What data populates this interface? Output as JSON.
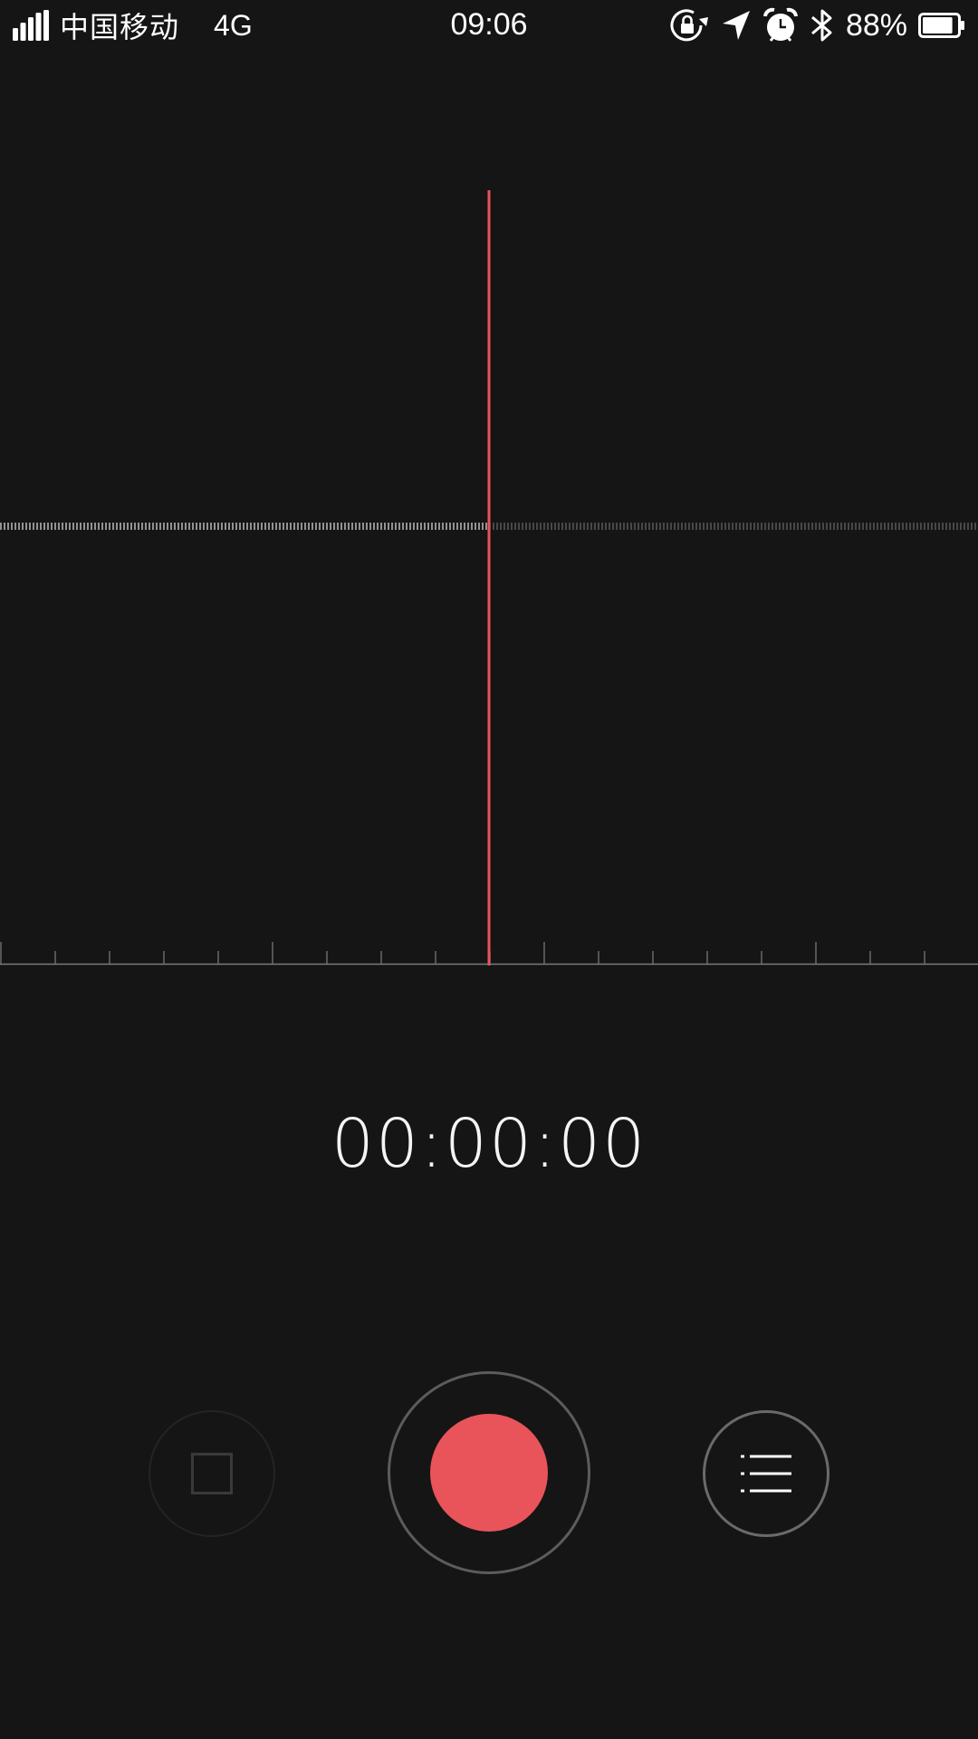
{
  "status_bar": {
    "carrier": "中国移动",
    "network": "4G",
    "time": "09:06",
    "battery_percent": "88%",
    "battery_level": 0.88,
    "icons": [
      "signal-icon",
      "rotation-lock-icon",
      "location-arrow-icon",
      "alarm-clock-icon",
      "bluetooth-icon",
      "battery-icon"
    ]
  },
  "recorder": {
    "timer": "00:00:00",
    "playhead_color": "#e8545a",
    "accent_color": "#e8545a",
    "controls": {
      "stop": "stop-icon",
      "record": "record-icon",
      "list": "list-icon"
    }
  }
}
